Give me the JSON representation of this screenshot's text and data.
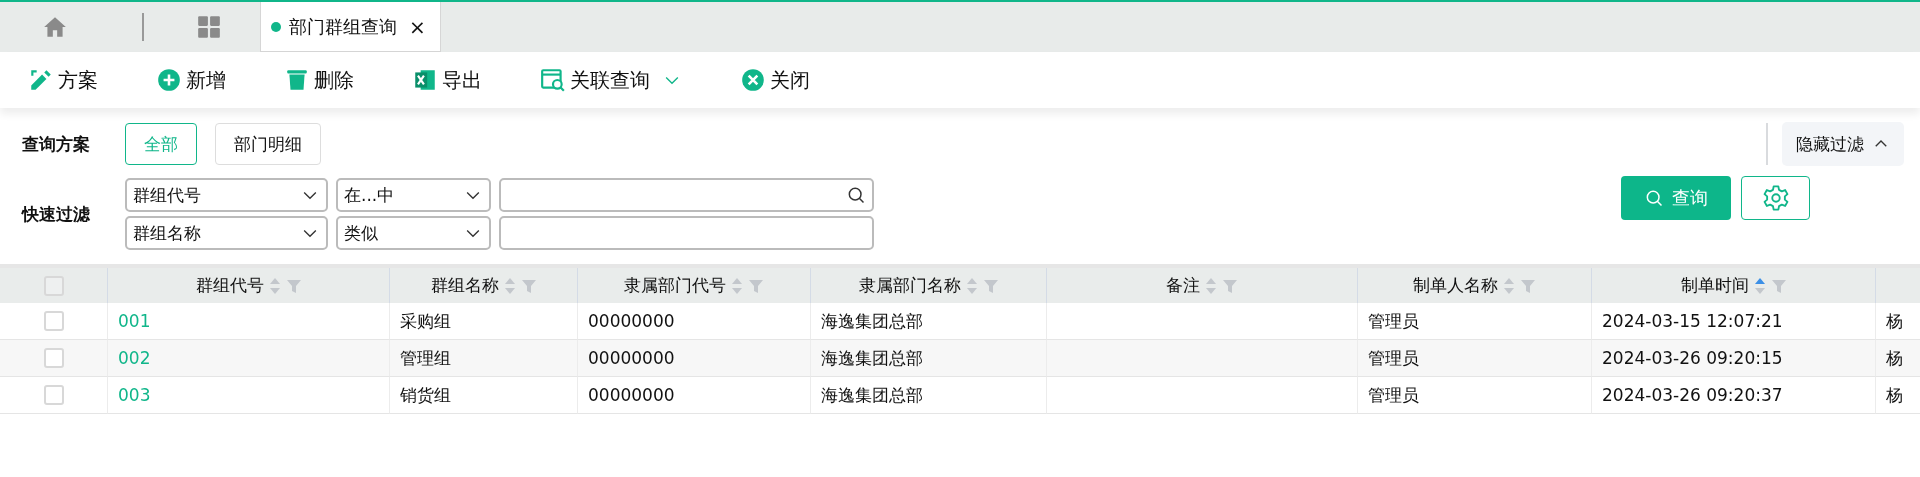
{
  "tabs": [
    {
      "label": "部门群组查询",
      "selected": true,
      "close": "×"
    }
  ],
  "toolbar": [
    {
      "kind": "scheme",
      "label": "方案"
    },
    {
      "kind": "add",
      "label": "新增"
    },
    {
      "kind": "delete",
      "label": "删除"
    },
    {
      "kind": "export",
      "label": "导出"
    },
    {
      "kind": "related",
      "label": "关联查询",
      "dropdown": true
    },
    {
      "kind": "close",
      "label": "关闭"
    }
  ],
  "filter": {
    "scheme_label": "查询方案",
    "schemes": [
      {
        "label": "全部",
        "selected": true
      },
      {
        "label": "部门明细",
        "selected": false
      }
    ],
    "quick_label": "快速过滤",
    "rows": [
      {
        "field": "群组代号",
        "operator": "在...中",
        "search_icon": true
      },
      {
        "field": "群组名称",
        "operator": "类似",
        "search_icon": false
      }
    ],
    "hide_button": "隐藏过滤",
    "query_button": "查询"
  },
  "table": {
    "select_all_checked": false,
    "columns": [
      {
        "label": "群组代号",
        "sorted_ascending": false
      },
      {
        "label": "群组名称",
        "sorted_ascending": false
      },
      {
        "label": "隶属部门代号",
        "sorted_ascending": false
      },
      {
        "label": "隶属部门名称",
        "sorted_ascending": false
      },
      {
        "label": "备注",
        "sorted_ascending": false
      },
      {
        "label": "制单人名称",
        "sorted_ascending": false
      },
      {
        "label": "制单时间",
        "sorted_ascending": true
      },
      {}
    ],
    "rows": [
      {
        "checked": false,
        "cells": [
          "001",
          "采购组",
          "00000000",
          "海逸集团总部",
          "",
          "管理员",
          "2024-03-15 12:07:21",
          "杨"
        ]
      },
      {
        "checked": false,
        "cells": [
          "002",
          "管理组",
          "00000000",
          "海逸集团总部",
          "",
          "管理员",
          "2024-03-26 09:20:15",
          "杨"
        ]
      },
      {
        "checked": false,
        "cells": [
          "003",
          "销货组",
          "00000000",
          "海逸集团总部",
          "",
          "管理员",
          "2024-03-26 09:20:37",
          "杨"
        ]
      }
    ]
  }
}
